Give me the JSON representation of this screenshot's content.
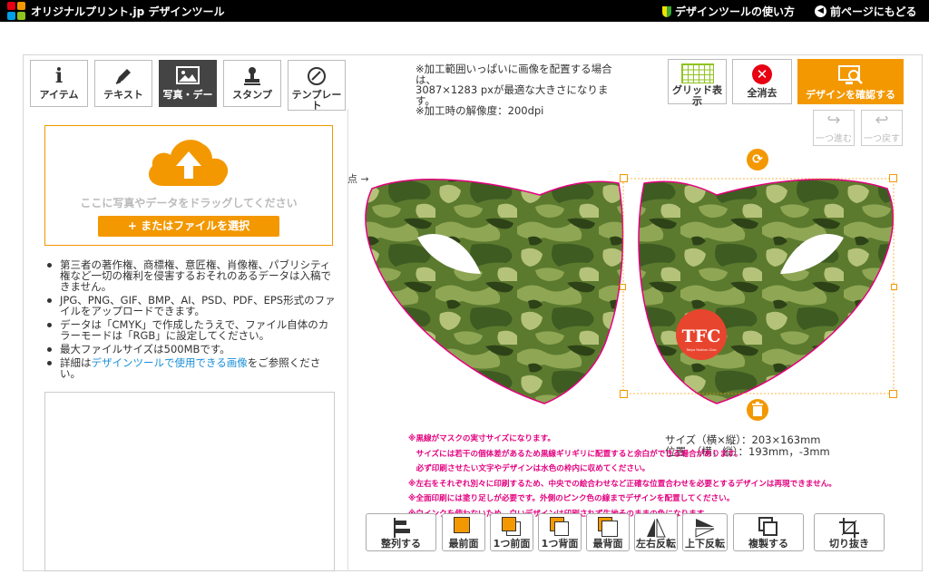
{
  "header": {
    "brand": "オリジナルプリント.jp デザインツール",
    "help_link": "デザインツールの使い方",
    "back_link": "前ページにもどる"
  },
  "tabs": [
    {
      "label": "アイテム",
      "icon": "info-icon"
    },
    {
      "label": "テキスト",
      "icon": "pen-icon"
    },
    {
      "label": "写真・デー",
      "icon": "image-icon"
    },
    {
      "label": "スタンプ",
      "icon": "stamp-icon"
    },
    {
      "label": "テンプレー",
      "icon": "template-icon"
    }
  ],
  "tab_overflow": "ト",
  "upload": {
    "drop_text": "ここに写真やデータをドラッグしてください",
    "file_button": "+ またはファイルを選択"
  },
  "notes": [
    "第三者の著作権、商標権、意匠権、肖像権、パブリシティ権など一切の権利を侵害するおそれのあるデータは入稿できません。",
    "JPG、PNG、GIF、BMP、AI、PSD、PDF、EPS形式のファイルをアップロードできます。",
    "データは「CMYK」で作成したうえで、ファイル自体のカラーモードは「RGB」に設定してください。",
    "最大ファイルサイズは500MBです。"
  ],
  "note_link": {
    "prefix": "詳細は",
    "link": "デザインツールで使用できる画像",
    "suffix": "をご参照ください。"
  },
  "info": {
    "line1": "※加工範囲いっぱいに画像を配置する場合は、",
    "line2": "3087×1283 pxが最適な大きさになります。",
    "line3": "※加工時の解像度：200dpi"
  },
  "toolbar": {
    "grid": "グリッド表示",
    "clear": "全消去",
    "confirm": "デザインを確認する",
    "redo": "一つ進む",
    "undo": "一つ戻す"
  },
  "canvas": {
    "side_label": "点 →",
    "logo_text": "TFC",
    "logo_small": "Tokyo Fashion Club"
  },
  "size_info": {
    "size": "サイズ（横×縦）：203×163mm",
    "position": "位置　（横，縦）：193mm，-3mm"
  },
  "pink_notes": [
    "※黒線がマスクの実寸サイズになります。",
    "　サイズには若干の個体差があるため黒線ギリギリに配置すると余白ができる場合があります。",
    "　必ず印刷させたい文字やデザインは水色の枠内に収めてください。",
    "※左右をそれぞれ別々に印刷するため、中央での絵合わせなど正確な位置合わせを必要とするデザインは再現できません。",
    "※全面印刷には塗り足しが必要です。外側のピンク色の線までデザインを配置してください。",
    "※白インクを使わないため、白いデザインは印刷されず生地そのままの色になります。"
  ],
  "bottom_buttons": [
    {
      "label": "整列する",
      "icon": "align-icon"
    },
    {
      "label": "最前面",
      "icon": "bring-front-icon"
    },
    {
      "label": "1つ前面",
      "icon": "bring-forward-icon"
    },
    {
      "label": "1つ背面",
      "icon": "send-backward-icon"
    },
    {
      "label": "最背面",
      "icon": "send-back-icon"
    },
    {
      "label": "左右反転",
      "icon": "flip-horizontal-icon"
    },
    {
      "label": "上下反転",
      "icon": "flip-vertical-icon"
    },
    {
      "label": "複製する",
      "icon": "duplicate-icon"
    },
    {
      "label": "切り抜き",
      "icon": "crop-icon"
    }
  ],
  "colors": {
    "accent": "#f39800",
    "danger": "#e60012",
    "pink": "#e4007f",
    "camo": [
      "#5b7a2e",
      "#8fa654",
      "#3e5b22",
      "#b5c27a",
      "#2e4218"
    ]
  }
}
